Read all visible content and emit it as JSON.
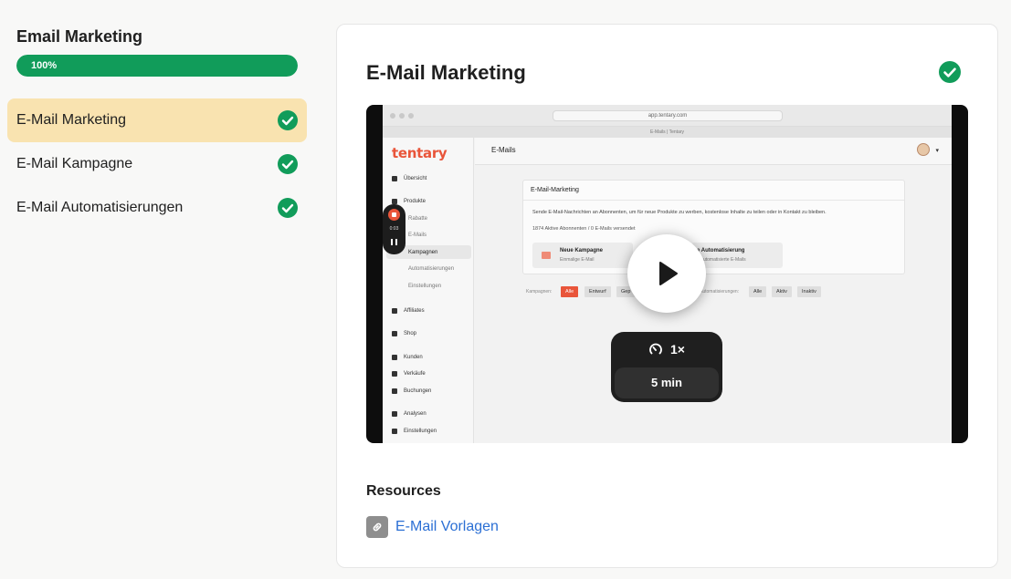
{
  "sidebar": {
    "course_title": "Email Marketing",
    "progress": {
      "percent": 100,
      "label": "100%"
    },
    "lessons": [
      {
        "label": "E-Mail Marketing",
        "active": true,
        "completed": true
      },
      {
        "label": "E-Mail Kampagne",
        "active": false,
        "completed": true
      },
      {
        "label": "E-Mail Automatisierungen",
        "active": false,
        "completed": true
      }
    ]
  },
  "main": {
    "title": "E-Mail Marketing",
    "completed": true,
    "video": {
      "speed": "1×",
      "duration": "5 min",
      "screen": {
        "url": "app.tentary.com",
        "tab": "E-Mails | Tentary",
        "brand": "tentary",
        "header": "E-Mails",
        "nav": [
          "Übersicht",
          "Produkte",
          "Rabatte",
          "E-Mails",
          "Kampagnen",
          "Automatisierungen",
          "Einstellungen",
          "Affiliates",
          "Shop",
          "Kunden",
          "Verkäufe",
          "Buchungen",
          "Analysen",
          "Einstellungen"
        ],
        "recording_time": "0:03",
        "card_title": "E-Mail-Marketing",
        "card_desc": "Sende E-Mail-Nachrichten an Abonnenten, um für neue Produkte zu werben, kostenlose Inhalte zu teilen oder in Kontakt zu bleiben.",
        "stats": "1874 Aktive Abonnenten / 0 E-Mails versendet",
        "tile1_title": "Neue Kampagne",
        "tile1_sub": "Einmalige E-Mail",
        "tile2_title": "e Automatisierung",
        "tile2_sub": "e automatisierte E-Mails",
        "campaign_label": "Kampagnen:",
        "campaign_chips": [
          "Alle",
          "Entwurf",
          "Gep"
        ],
        "auto_label": "Automatisierungen:",
        "auto_chips": [
          "Alle",
          "Aktiv",
          "Inaktiv"
        ]
      }
    },
    "resources": {
      "title": "Resources",
      "links": [
        {
          "label": "E-Mail Vorlagen",
          "icon": "link-icon"
        }
      ]
    }
  },
  "colors": {
    "accent_green": "#119c5a",
    "active_lesson_bg": "#f9e3b0",
    "link_blue": "#2b6fd4",
    "brand_orange": "#e9553a"
  }
}
